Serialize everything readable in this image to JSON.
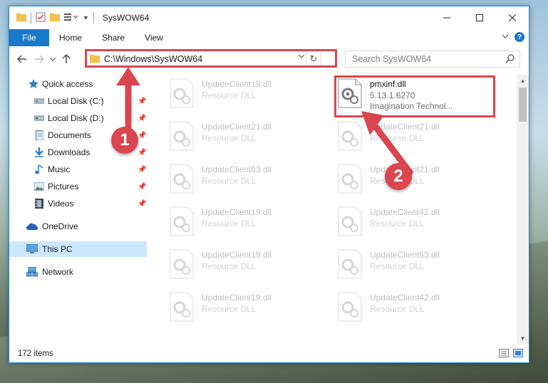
{
  "window": {
    "title": "SysWOW64",
    "controls": [
      "minimize",
      "maximize",
      "close"
    ]
  },
  "ribbon": {
    "tabs": [
      "File",
      "Home",
      "Share",
      "View"
    ]
  },
  "navigation": {
    "address": "C:\\Windows\\SysWOW64",
    "search_placeholder": "Search SysWOW64"
  },
  "sidebar": {
    "items": [
      {
        "label": "Quick access",
        "icon": "star-icon"
      },
      {
        "label": "Local Disk (C:)",
        "icon": "drive-icon",
        "pinned": true
      },
      {
        "label": "Local Disk (D:)",
        "icon": "drive-icon",
        "pinned": true
      },
      {
        "label": "Documents",
        "icon": "documents-icon",
        "pinned": true
      },
      {
        "label": "Downloads",
        "icon": "download-icon",
        "pinned": true
      },
      {
        "label": "Music",
        "icon": "music-icon",
        "pinned": true
      },
      {
        "label": "Pictures",
        "icon": "pictures-icon",
        "pinned": true
      },
      {
        "label": "Videos",
        "icon": "videos-icon",
        "pinned": true
      },
      {
        "label": "OneDrive",
        "icon": "cloud-icon"
      },
      {
        "label": "This PC",
        "icon": "computer-icon",
        "selected": true
      },
      {
        "label": "Network",
        "icon": "network-icon"
      }
    ]
  },
  "files": {
    "highlighted": {
      "name": "pmxinf.dll",
      "version": "5.13.1.6270",
      "company": "Imagination Technol..."
    },
    "left_column": [
      {
        "name": "UpdateClient19.dll",
        "type": "Resource DLL"
      },
      {
        "name": "UpdateClient21.dll",
        "type": "Resource DLL"
      },
      {
        "name": "UpdateClient63.dll",
        "type": "Resource DLL"
      },
      {
        "name": "UpdateClient19.dll",
        "type": "Resource DLL"
      },
      {
        "name": "UpdateClient19.dll",
        "type": "Resource DLL"
      },
      {
        "name": "UpdateClient19.dll",
        "type": "Resource DLL"
      }
    ],
    "right_column": [
      {
        "name": "UpdateClient21.dll",
        "type": "Resource DLL"
      },
      {
        "name": "UpdateClient21.dll",
        "type": "Resource DLL"
      },
      {
        "name": "UpdateClient42.dll",
        "type": "Resource DLL"
      },
      {
        "name": "UpdateClient63.dll",
        "type": "Resource DLL"
      },
      {
        "name": "UpdateClient42.dll",
        "type": "Resource DLL"
      }
    ]
  },
  "status": {
    "item_count": "172 items"
  },
  "annotations": {
    "step1": "1",
    "step2": "2",
    "color": "#d9464f"
  },
  "colors": {
    "accent": "#1979ca",
    "selection": "#cce8ff",
    "annotation": "#d9464f"
  }
}
